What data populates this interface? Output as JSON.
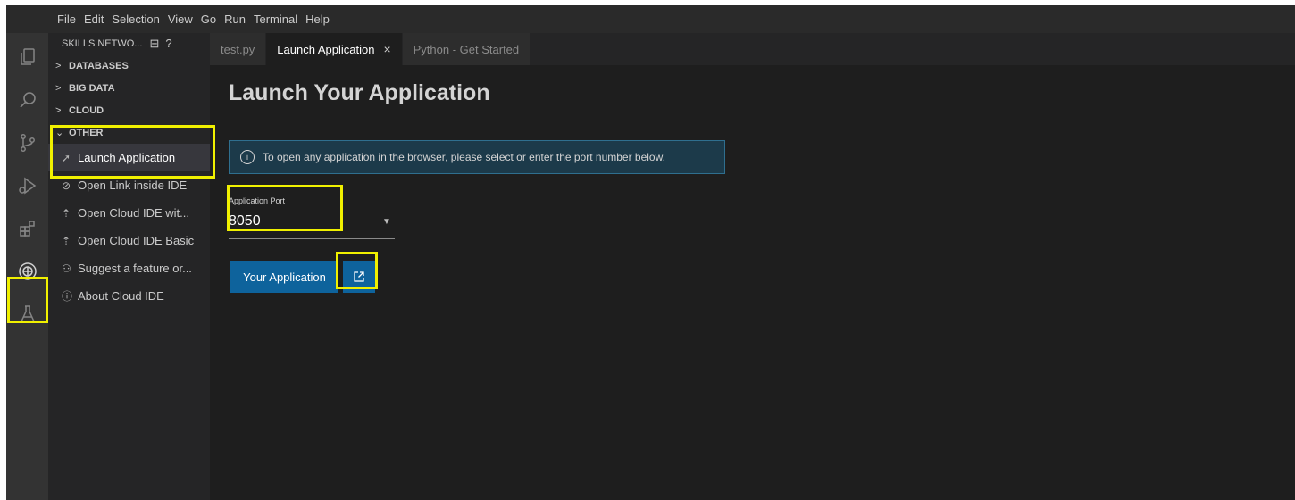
{
  "menu": [
    "File",
    "Edit",
    "Selection",
    "View",
    "Go",
    "Run",
    "Terminal",
    "Help"
  ],
  "activity_bar": {
    "icons": [
      "explorer-icon",
      "search-icon",
      "source-control-icon",
      "run-debug-icon",
      "extensions-icon",
      "skills-network-icon",
      "testing-flask-icon"
    ]
  },
  "sidebar": {
    "title": "SKILLS NETWO...",
    "sections": [
      {
        "label": "DATABASES",
        "state": "collapsed"
      },
      {
        "label": "BIG DATA",
        "state": "collapsed"
      },
      {
        "label": "CLOUD",
        "state": "collapsed"
      },
      {
        "label": "OTHER",
        "state": "expanded"
      }
    ],
    "items": [
      {
        "label": "Launch Application",
        "icon": "rocket-icon"
      },
      {
        "label": "Open Link inside IDE",
        "icon": "link-icon"
      },
      {
        "label": "Open Cloud IDE wit...",
        "icon": "cloud-upload-icon"
      },
      {
        "label": "Open Cloud IDE Basic",
        "icon": "cloud-upload-icon"
      },
      {
        "label": "Suggest a feature or...",
        "icon": "people-icon"
      },
      {
        "label": "About Cloud IDE",
        "icon": "info-icon"
      }
    ]
  },
  "tabs": [
    {
      "label": "test.py",
      "active": false
    },
    {
      "label": "Launch Application",
      "active": true,
      "close": "×"
    },
    {
      "label": "Python - Get Started",
      "active": false
    }
  ],
  "page": {
    "title": "Launch Your Application",
    "notice": "To open any application in the browser, please select or enter the port number below.",
    "port_label": "Application Port",
    "port_value": "8050",
    "app_button": "Your Application"
  },
  "colors": {
    "accent": "#0e639c",
    "highlight": "#f0f000",
    "notice_bg": "#1c3a4a"
  }
}
